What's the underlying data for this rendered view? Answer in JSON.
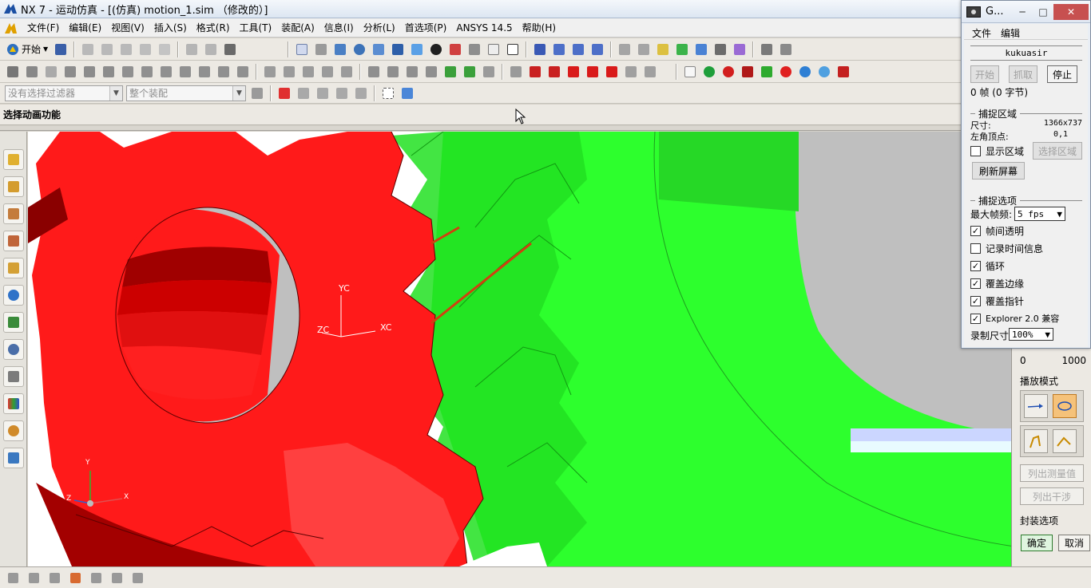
{
  "window": {
    "title": "NX 7 - 运动仿真 - [(仿真) motion_1.sim （修改的）]"
  },
  "menu": [
    "文件(F)",
    "编辑(E)",
    "视图(V)",
    "插入(S)",
    "格式(R)",
    "工具(T)",
    "装配(A)",
    "信息(I)",
    "分析(L)",
    "首选项(P)",
    "ANSYS 14.5",
    "帮助(H)"
  ],
  "toolbar": {
    "start_label": "开始",
    "filter_placeholder": "没有选择过滤器",
    "assembly_scope": "整个装配"
  },
  "cue_line": "选择动画功能",
  "axes": {
    "work": {
      "y": "YC",
      "x": "XC",
      "z": "ZC"
    },
    "abs": {
      "y": "Y",
      "x": "X",
      "z": "Z"
    }
  },
  "colors": {
    "red_gear": "#ff1a1a",
    "red_dark": "#c40000",
    "green_gear": "#2dff2d",
    "green_dark": "#1fcf1f",
    "background": "#ffffff",
    "cylinder": "#bfbfbf"
  },
  "motion_panel": {
    "scale_min": "0",
    "scale_max": "1000",
    "playback_mode_label": "播放模式",
    "list_measure_label": "列出测量值",
    "list_interference_label": "列出干涉",
    "package_options_label": "封装选项",
    "ok_label": "确定",
    "cancel_label": "取消"
  },
  "capture_window": {
    "title": "G...",
    "min_glyph": "─",
    "max_glyph": "□",
    "close_glyph": "✕",
    "menu": [
      "文件",
      "编辑"
    ],
    "name": "kukuasir",
    "buttons": {
      "start": "开始",
      "capture": "抓取",
      "stop": "停止"
    },
    "frame_info": "0 帧 (0 字节)",
    "capture_area_group": "捕捉区域",
    "size_label": "尺寸:",
    "size_value": "1366x737",
    "origin_label": "左角顶点:",
    "origin_value": "0,1",
    "show_area_label": "显示区域",
    "select_area_label": "选择区域",
    "refresh_label": "刷新屏幕",
    "capture_options_group": "捕捉选项",
    "max_fps_label": "最大帧频:",
    "max_fps_value": "5 fps",
    "options": [
      {
        "label": "帧间透明",
        "checked": true
      },
      {
        "label": "记录时间信息",
        "checked": false
      },
      {
        "label": "循环",
        "checked": true
      },
      {
        "label": "覆盖边缘",
        "checked": true
      },
      {
        "label": "覆盖指针",
        "checked": true
      },
      {
        "label": "Explorer 2.0 兼容",
        "checked": true
      }
    ],
    "record_size_label": "录制尺寸",
    "record_size_value": "100%"
  }
}
